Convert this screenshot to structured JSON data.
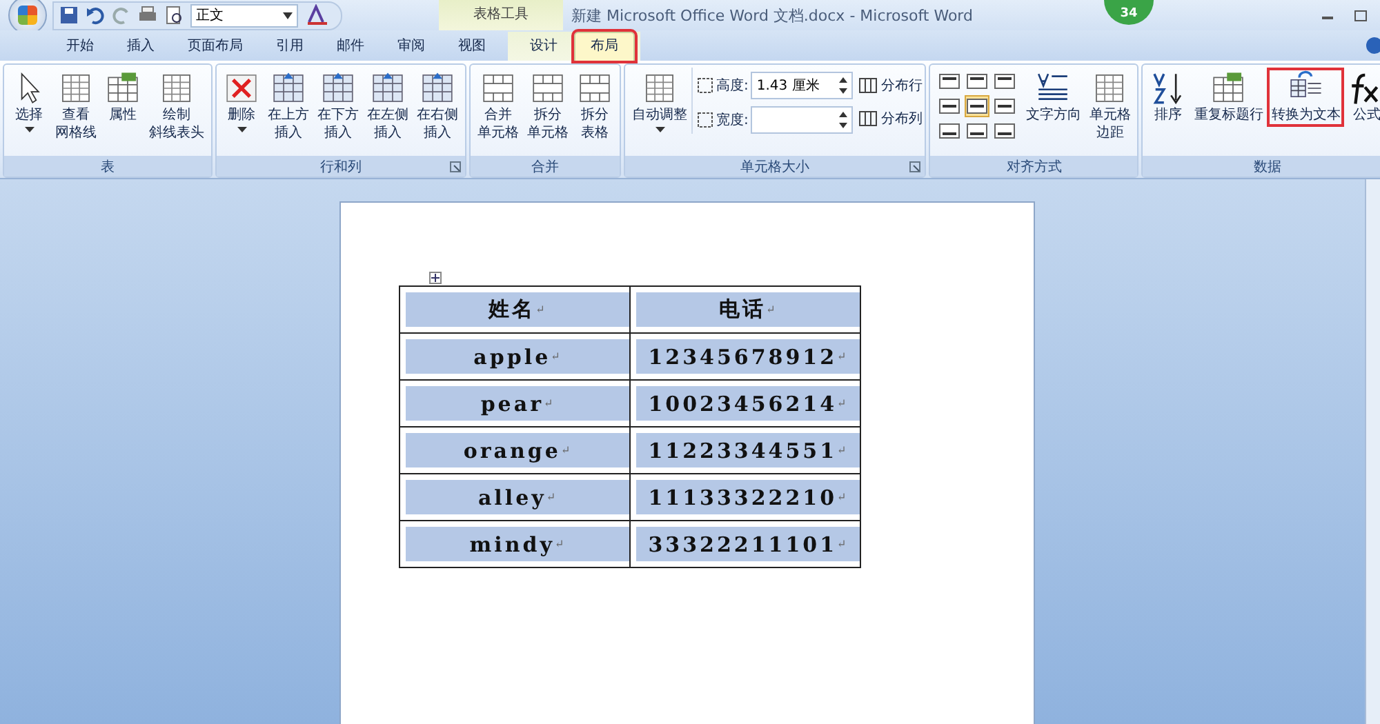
{
  "window": {
    "title": "新建 Microsoft Office Word 文档.docx - Microsoft Word",
    "badge": "34"
  },
  "quick_access": {
    "style_box": "正文"
  },
  "tabs": [
    {
      "label": "开始",
      "selected": false
    },
    {
      "label": "插入",
      "selected": false
    },
    {
      "label": "页面布局",
      "selected": false
    },
    {
      "label": "引用",
      "selected": false
    },
    {
      "label": "邮件",
      "selected": false
    },
    {
      "label": "审阅",
      "selected": false
    },
    {
      "label": "视图",
      "selected": false
    }
  ],
  "context_tabs": {
    "title": "表格工具",
    "tabs": [
      {
        "label": "设计",
        "selected": false
      },
      {
        "label": "布局",
        "selected": true,
        "highlighted": true
      }
    ]
  },
  "groups": [
    {
      "label": "表",
      "items": [
        {
          "kind": "pointer",
          "lines": [
            "选择"
          ],
          "dropdown": true
        },
        {
          "kind": "grid",
          "lines": [
            "查看",
            "网格线"
          ]
        },
        {
          "kind": "props",
          "lines": [
            "属性"
          ]
        },
        {
          "kind": "grid",
          "lines": [
            "绘制",
            "斜线表头"
          ]
        }
      ]
    },
    {
      "label": "行和列",
      "launcher": true,
      "items": [
        {
          "kind": "delete",
          "lines": [
            "删除"
          ],
          "dropdown": true
        },
        {
          "kind": "insert",
          "lines": [
            "在上方",
            "插入"
          ]
        },
        {
          "kind": "insert",
          "lines": [
            "在下方",
            "插入"
          ]
        },
        {
          "kind": "insert",
          "lines": [
            "在左侧",
            "插入"
          ]
        },
        {
          "kind": "insert",
          "lines": [
            "在右侧",
            "插入"
          ]
        }
      ]
    },
    {
      "label": "合并",
      "items": [
        {
          "kind": "merge",
          "lines": [
            "合并",
            "单元格"
          ]
        },
        {
          "kind": "merge",
          "lines": [
            "拆分",
            "单元格"
          ]
        },
        {
          "kind": "merge",
          "lines": [
            "拆分",
            "表格"
          ]
        }
      ]
    },
    {
      "label": "单元格大小",
      "launcher": true,
      "items": [
        {
          "kind": "grid",
          "lines": [
            "自动调整"
          ],
          "dropdown": true
        },
        {
          "kind": "size",
          "fields": [
            {
              "label": "高度:",
              "value": "1.43 厘米"
            },
            {
              "label": "宽度:"
            }
          ],
          "buttons": [
            "分布行",
            "分布列"
          ]
        }
      ]
    },
    {
      "label": "对齐方式",
      "items": [
        {
          "kind": "align",
          "cells": [
            {
              "selected": false
            },
            {
              "selected": false
            },
            {
              "selected": false
            },
            {
              "selected": false
            },
            {
              "selected": true
            },
            {
              "selected": false
            },
            {
              "selected": false
            },
            {
              "selected": false
            },
            {
              "selected": false
            }
          ]
        },
        {
          "kind": "textdir",
          "lines": [
            "文字方向"
          ]
        },
        {
          "kind": "grid",
          "lines": [
            "单元格",
            "边距"
          ]
        }
      ]
    },
    {
      "label": "数据",
      "items": [
        {
          "kind": "sort",
          "lines": [
            "排序"
          ]
        },
        {
          "kind": "props",
          "lines": [
            "重复标题行"
          ]
        },
        {
          "kind": "convert",
          "lines": [
            "转换为文本"
          ],
          "highlighted": true
        },
        {
          "kind": "formula",
          "lines": [
            "公式"
          ]
        }
      ]
    }
  ],
  "document": {
    "end_mark": "↵",
    "table": {
      "rows": [
        [
          "姓名",
          "电话"
        ],
        [
          "apple",
          "12345678912"
        ],
        [
          "pear",
          "10023456214"
        ],
        [
          "orange",
          "11223344551"
        ],
        [
          "alley",
          "11133322210"
        ],
        [
          "mindy",
          "33322211101"
        ]
      ]
    }
  }
}
